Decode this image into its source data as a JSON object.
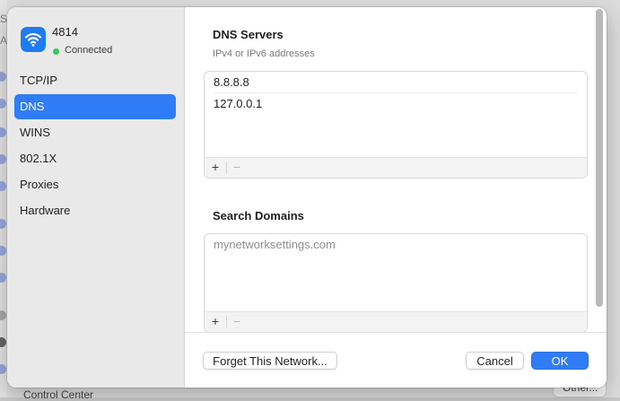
{
  "background": {
    "peek_s": "S",
    "peek_a": "A",
    "control_center": "Control Center",
    "other_button": "Other..."
  },
  "sidebar": {
    "network_name": "4814",
    "status": "Connected",
    "status_color": "#34c759",
    "accent": "#2f7cf6",
    "items": [
      {
        "label": "TCP/IP"
      },
      {
        "label": "DNS",
        "active": true
      },
      {
        "label": "WINS"
      },
      {
        "label": "802.1X"
      },
      {
        "label": "Proxies"
      },
      {
        "label": "Hardware"
      }
    ]
  },
  "dns": {
    "title": "DNS Servers",
    "subtitle": "IPv4 or IPv6 addresses",
    "servers": [
      "8.8.8.8",
      "127.0.0.1"
    ],
    "add_label": "+",
    "remove_label": "−"
  },
  "search": {
    "title": "Search Domains",
    "placeholder": "mynetworksettings.com",
    "add_label": "+",
    "remove_label": "−"
  },
  "buttons": {
    "forget": "Forget This Network...",
    "cancel": "Cancel",
    "ok": "OK"
  }
}
